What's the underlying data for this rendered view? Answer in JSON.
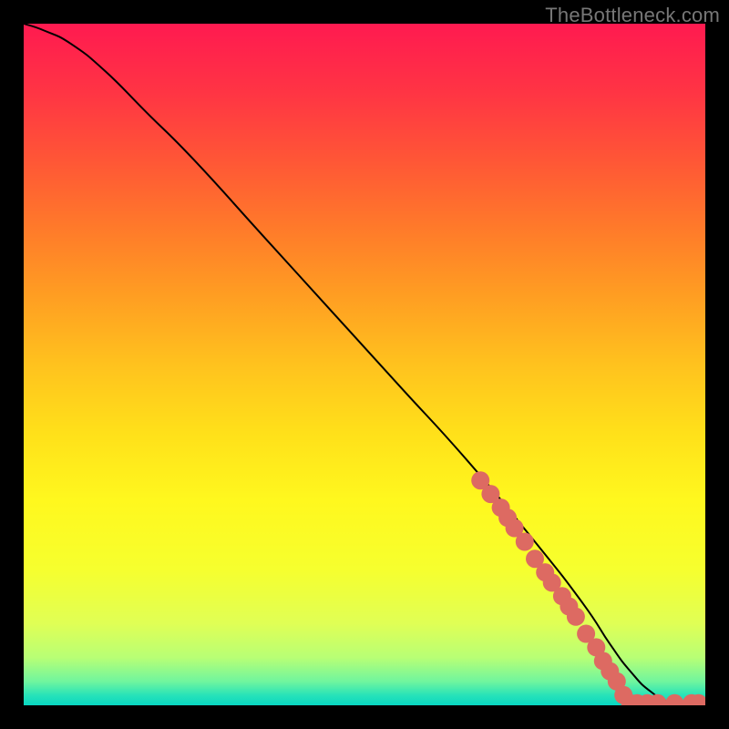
{
  "watermark": "TheBottleneck.com",
  "colors": {
    "marker": "#dd6a62",
    "curve": "#000000",
    "gradient_stops": [
      {
        "offset": 0.0,
        "color": "#ff1a50"
      },
      {
        "offset": 0.1,
        "color": "#ff3444"
      },
      {
        "offset": 0.2,
        "color": "#ff5636"
      },
      {
        "offset": 0.3,
        "color": "#ff7a2a"
      },
      {
        "offset": 0.4,
        "color": "#ff9e22"
      },
      {
        "offset": 0.5,
        "color": "#ffc21e"
      },
      {
        "offset": 0.6,
        "color": "#ffe01a"
      },
      {
        "offset": 0.7,
        "color": "#fff81e"
      },
      {
        "offset": 0.8,
        "color": "#f6ff2e"
      },
      {
        "offset": 0.88,
        "color": "#e0ff55"
      },
      {
        "offset": 0.93,
        "color": "#b8ff75"
      },
      {
        "offset": 0.965,
        "color": "#70f59e"
      },
      {
        "offset": 0.985,
        "color": "#28e3b8"
      },
      {
        "offset": 1.0,
        "color": "#08d6c2"
      }
    ]
  },
  "chart_data": {
    "type": "line",
    "xlabel": "",
    "ylabel": "",
    "title": "",
    "xlim": [
      0,
      100
    ],
    "ylim": [
      0,
      100
    ],
    "series": [
      {
        "name": "curve",
        "x": [
          0,
          3,
          7,
          12,
          18,
          25,
          35,
          45,
          55,
          65,
          75,
          82,
          86,
          89,
          92,
          95,
          100
        ],
        "y": [
          100,
          99,
          97,
          93,
          87,
          80,
          69,
          58,
          47,
          36,
          24,
          15,
          9,
          5,
          2,
          0.5,
          0.3
        ]
      }
    ],
    "markers": [
      {
        "x": 67,
        "y": 33
      },
      {
        "x": 68.5,
        "y": 31
      },
      {
        "x": 70,
        "y": 29
      },
      {
        "x": 71,
        "y": 27.5
      },
      {
        "x": 72,
        "y": 26
      },
      {
        "x": 73.5,
        "y": 24
      },
      {
        "x": 75,
        "y": 21.5
      },
      {
        "x": 76.5,
        "y": 19.5
      },
      {
        "x": 77.5,
        "y": 18
      },
      {
        "x": 79,
        "y": 16
      },
      {
        "x": 80,
        "y": 14.5
      },
      {
        "x": 81,
        "y": 13
      },
      {
        "x": 82.5,
        "y": 10.5
      },
      {
        "x": 84,
        "y": 8.5
      },
      {
        "x": 85,
        "y": 6.5
      },
      {
        "x": 86,
        "y": 5
      },
      {
        "x": 87,
        "y": 3.5
      },
      {
        "x": 88,
        "y": 1.5
      },
      {
        "x": 89,
        "y": 0.3
      },
      {
        "x": 90,
        "y": 0.3
      },
      {
        "x": 91.5,
        "y": 0.3
      },
      {
        "x": 93,
        "y": 0.3
      },
      {
        "x": 95.5,
        "y": 0.3
      },
      {
        "x": 98,
        "y": 0.3
      },
      {
        "x": 99,
        "y": 0.3
      }
    ]
  }
}
